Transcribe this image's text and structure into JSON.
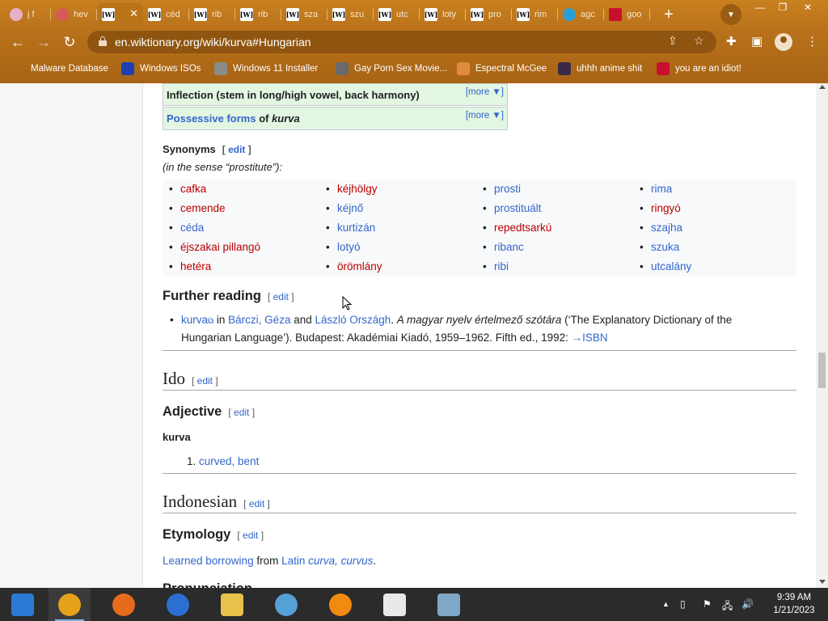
{
  "tabs": [
    {
      "label": "j f",
      "fav": "",
      "fav_style": "pink",
      "icon": "anime-avatar-icon"
    },
    {
      "label": "hev",
      "fav": "",
      "fav_style": "lips",
      "icon": "lips-icon"
    },
    {
      "label": "",
      "fav": "[W]",
      "fav_style": "",
      "icon": "wiktionary-icon",
      "active": true
    },
    {
      "label": "céd",
      "fav": "[W]",
      "fav_style": "",
      "icon": "wiktionary-icon"
    },
    {
      "label": "rib",
      "fav": "[W]",
      "fav_style": "",
      "icon": "wiktionary-icon"
    },
    {
      "label": "rib",
      "fav": "[W]",
      "fav_style": "",
      "icon": "wiktionary-icon"
    },
    {
      "label": "sza",
      "fav": "[W]",
      "fav_style": "",
      "icon": "wiktionary-icon"
    },
    {
      "label": "szu",
      "fav": "[W]",
      "fav_style": "",
      "icon": "wiktionary-icon"
    },
    {
      "label": "utc",
      "fav": "[W]",
      "fav_style": "",
      "icon": "wiktionary-icon"
    },
    {
      "label": "loty",
      "fav": "[W]",
      "fav_style": "",
      "icon": "wiktionary-icon"
    },
    {
      "label": "pro",
      "fav": "[W]",
      "fav_style": "",
      "icon": "wiktionary-icon"
    },
    {
      "label": "rim",
      "fav": "[W]",
      "fav_style": "",
      "icon": "wiktionary-icon"
    },
    {
      "label": "agc",
      "fav": "",
      "fav_style": "tg",
      "icon": "telegram-icon"
    },
    {
      "label": "goo",
      "fav": "",
      "fav_style": "uk",
      "icon": "uk-flag-icon"
    }
  ],
  "toolbar": {
    "url": "en.wiktionary.org/wiki/kurva#Hungarian"
  },
  "bookmarks": [
    {
      "label": "Malware Database",
      "icon": "none",
      "color": ""
    },
    {
      "label": "Windows ISOs",
      "icon": "x-icon",
      "color": "#1f3fb0"
    },
    {
      "label": "Windows 11 Installer",
      "icon": "installer-icon",
      "color": "#8a8a8a"
    },
    {
      "label": "Gay Porn Sex Movie...",
      "icon": "globe-icon",
      "color": "#6a6a6a"
    },
    {
      "label": "Espectral McGee",
      "icon": "anime-avatar-icon",
      "color": "#e08a40"
    },
    {
      "label": "uhhh anime shit",
      "icon": "anime-avatar-icon",
      "color": "#3a2a4a"
    },
    {
      "label": "you are an idiot!",
      "icon": "uk-flag-icon",
      "color": "#c8102e"
    }
  ],
  "page": {
    "nav_inflection": "Inflection (stem in long/high vowel, back harmony)",
    "nav_possessive_pre": "Possessive forms",
    "nav_possessive_of": " of ",
    "nav_possessive_word": "kurva",
    "more_label": "[more ▼]",
    "synonyms_heading": "Synonyms",
    "edit_label": "edit",
    "synonyms_gloss": "(in the sense “prostitute”):",
    "synonyms_columns": [
      [
        {
          "text": "cafka",
          "red": true
        },
        {
          "text": "cemende",
          "red": true
        },
        {
          "text": "céda",
          "red": false
        },
        {
          "text": "éjszakai pillangó",
          "red": true
        },
        {
          "text": "hetéra",
          "red": true
        }
      ],
      [
        {
          "text": "kéjhölgy",
          "red": true
        },
        {
          "text": "kéjnő",
          "red": false
        },
        {
          "text": "kurtizán",
          "red": false
        },
        {
          "text": "lotyó",
          "red": false
        },
        {
          "text": "örömlány",
          "red": true
        }
      ],
      [
        {
          "text": "prosti",
          "red": false
        },
        {
          "text": "prostituált",
          "red": false
        },
        {
          "text": "repedtsarkú",
          "red": true
        },
        {
          "text": "ribanc",
          "red": false
        },
        {
          "text": "ribi",
          "red": false
        }
      ],
      [
        {
          "text": "rima",
          "red": false
        },
        {
          "text": "ringyó",
          "red": true
        },
        {
          "text": "szajha",
          "red": false
        },
        {
          "text": "szuka",
          "red": false
        },
        {
          "text": "utcalány",
          "red": false
        }
      ]
    ],
    "further_reading_heading": "Further reading",
    "fr_link": "kurva",
    "fr_in": " in ",
    "fr_author1": "Bárczi, Géza",
    "fr_and": " and ",
    "fr_author2": "László Országh",
    "fr_title": "A magyar nyelv értelmező szótára",
    "fr_rest1": " (‘The Explanatory Dictionary of the",
    "fr_rest2": "Hungarian Language’). Budapest: Akadémiai Kiadó, 1959–1962. Fifth ed., 1992: ",
    "fr_isbn": "→ISBN",
    "ido_heading": "Ido",
    "adjective_heading": "Adjective",
    "headword": "kurva",
    "def_number": "1.",
    "def_text": "curved, bent",
    "indonesian_heading": "Indonesian",
    "etymology_heading": "Etymology",
    "etym_link": "Learned borrowing",
    "etym_from": " from ",
    "etym_latin": "Latin",
    "etym_words": "curva, curvus",
    "etym_end": ".",
    "next_heading": "Pronunciation"
  },
  "taskbar": {
    "apps": [
      {
        "icon": "photo-viewer-icon",
        "color": "#2a7ad6"
      },
      {
        "icon": "chrome-icon",
        "color": "#e3a21a",
        "running": true
      },
      {
        "icon": "firefox-icon",
        "color": "#e86a1c"
      },
      {
        "icon": "edge-icon",
        "color": "#2b6fd2"
      },
      {
        "icon": "file-explorer-icon",
        "color": "#e8c14a"
      },
      {
        "icon": "people-icon",
        "color": "#56a0d8"
      },
      {
        "icon": "vlc-icon",
        "color": "#f08a10"
      },
      {
        "icon": "7zip-icon",
        "color": "#e9e9e9"
      },
      {
        "icon": "task-manager-icon",
        "color": "#7fa8c8"
      }
    ],
    "time": "9:39 AM",
    "date": "1/21/2023"
  }
}
